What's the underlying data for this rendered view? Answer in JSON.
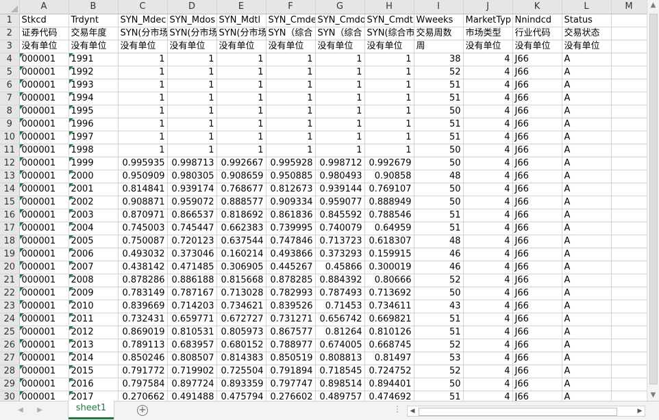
{
  "sheet": {
    "col_letters": [
      "A",
      "B",
      "C",
      "D",
      "E",
      "F",
      "G",
      "H",
      "I",
      "J",
      "K",
      "L",
      "M"
    ],
    "fields": [
      "Stkcd",
      "Trdynt",
      "SYN_Mdec",
      "SYN_Mdos",
      "SYN_Mdtl",
      "SYN_Cmde",
      "SYN_Cmdo",
      "SYN_Cmdt",
      "Wweeks",
      "MarketTyp",
      "Nnindcd",
      "Status",
      ""
    ],
    "cn_names": [
      "证券代码",
      "交易年度",
      "SYN(分市场",
      "SYN(分市场",
      "SYN(分市场",
      "SYN（综合",
      "SYN（综合",
      "SYN(综合市",
      "交易周数",
      "市场类型",
      "行业代码",
      "交易状态",
      ""
    ],
    "units": [
      "没有单位",
      "没有单位",
      "没有单位",
      "没有单位",
      "没有单位",
      "没有单位",
      "没有单位",
      "没有单位",
      "周",
      "没有单位",
      "没有单位",
      "没有单位",
      ""
    ],
    "records": [
      [
        "000001",
        "1991",
        "1",
        "1",
        "1",
        "1",
        "1",
        "1",
        "38",
        "4",
        "J66",
        "A"
      ],
      [
        "000001",
        "1992",
        "1",
        "1",
        "1",
        "1",
        "1",
        "1",
        "52",
        "4",
        "J66",
        "A"
      ],
      [
        "000001",
        "1993",
        "1",
        "1",
        "1",
        "1",
        "1",
        "1",
        "51",
        "4",
        "J66",
        "A"
      ],
      [
        "000001",
        "1994",
        "1",
        "1",
        "1",
        "1",
        "1",
        "1",
        "51",
        "4",
        "J66",
        "A"
      ],
      [
        "000001",
        "1995",
        "1",
        "1",
        "1",
        "1",
        "1",
        "1",
        "50",
        "4",
        "J66",
        "A"
      ],
      [
        "000001",
        "1996",
        "1",
        "1",
        "1",
        "1",
        "1",
        "1",
        "51",
        "4",
        "J66",
        "A"
      ],
      [
        "000001",
        "1997",
        "1",
        "1",
        "1",
        "1",
        "1",
        "1",
        "51",
        "4",
        "J66",
        "A"
      ],
      [
        "000001",
        "1998",
        "1",
        "1",
        "1",
        "1",
        "1",
        "1",
        "50",
        "4",
        "J66",
        "A"
      ],
      [
        "000001",
        "1999",
        "0.995935",
        "0.998713",
        "0.992667",
        "0.995928",
        "0.998712",
        "0.992679",
        "50",
        "4",
        "J66",
        "A"
      ],
      [
        "000001",
        "2000",
        "0.950909",
        "0.980305",
        "0.908659",
        "0.950885",
        "0.980493",
        "0.90858",
        "48",
        "4",
        "J66",
        "A"
      ],
      [
        "000001",
        "2001",
        "0.814841",
        "0.939174",
        "0.768677",
        "0.812673",
        "0.939144",
        "0.769107",
        "50",
        "4",
        "J66",
        "A"
      ],
      [
        "000001",
        "2002",
        "0.908871",
        "0.959072",
        "0.888577",
        "0.909334",
        "0.959077",
        "0.888949",
        "50",
        "4",
        "J66",
        "A"
      ],
      [
        "000001",
        "2003",
        "0.870971",
        "0.866537",
        "0.818692",
        "0.861836",
        "0.845592",
        "0.788546",
        "51",
        "4",
        "J66",
        "A"
      ],
      [
        "000001",
        "2004",
        "0.745003",
        "0.745447",
        "0.662383",
        "0.739995",
        "0.740079",
        "0.64959",
        "51",
        "4",
        "J66",
        "A"
      ],
      [
        "000001",
        "2005",
        "0.750087",
        "0.720123",
        "0.637544",
        "0.747846",
        "0.713723",
        "0.618307",
        "48",
        "4",
        "J66",
        "A"
      ],
      [
        "000001",
        "2006",
        "0.493032",
        "0.373046",
        "0.160214",
        "0.493866",
        "0.373293",
        "0.159915",
        "46",
        "4",
        "J66",
        "A"
      ],
      [
        "000001",
        "2007",
        "0.438142",
        "0.471485",
        "0.306905",
        "0.445267",
        "0.45866",
        "0.300019",
        "46",
        "4",
        "J66",
        "A"
      ],
      [
        "000001",
        "2008",
        "0.878286",
        "0.886188",
        "0.815668",
        "0.878285",
        "0.884392",
        "0.80666",
        "52",
        "4",
        "J66",
        "A"
      ],
      [
        "000001",
        "2009",
        "0.783149",
        "0.787167",
        "0.713028",
        "0.782993",
        "0.787493",
        "0.713692",
        "50",
        "4",
        "J66",
        "A"
      ],
      [
        "000001",
        "2010",
        "0.839669",
        "0.714203",
        "0.734621",
        "0.839526",
        "0.71453",
        "0.734611",
        "43",
        "4",
        "J66",
        "A"
      ],
      [
        "000001",
        "2011",
        "0.732431",
        "0.659771",
        "0.672727",
        "0.731271",
        "0.656742",
        "0.669821",
        "51",
        "4",
        "J66",
        "A"
      ],
      [
        "000001",
        "2012",
        "0.869019",
        "0.810531",
        "0.805973",
        "0.867577",
        "0.81264",
        "0.810126",
        "51",
        "4",
        "J66",
        "A"
      ],
      [
        "000001",
        "2013",
        "0.789113",
        "0.683957",
        "0.680152",
        "0.788977",
        "0.674005",
        "0.668745",
        "52",
        "4",
        "J66",
        "A"
      ],
      [
        "000001",
        "2014",
        "0.850246",
        "0.808507",
        "0.814383",
        "0.850519",
        "0.808813",
        "0.81497",
        "53",
        "4",
        "J66",
        "A"
      ],
      [
        "000001",
        "2015",
        "0.791772",
        "0.719902",
        "0.725504",
        "0.791894",
        "0.718545",
        "0.724752",
        "52",
        "4",
        "J66",
        "A"
      ],
      [
        "000001",
        "2016",
        "0.797584",
        "0.897724",
        "0.893359",
        "0.797747",
        "0.898514",
        "0.894401",
        "50",
        "4",
        "J66",
        "A"
      ],
      [
        "000001",
        "2017",
        "0.270662",
        "0.491488",
        "0.475794",
        "0.276602",
        "0.489757",
        "0.474692",
        "51",
        "4",
        "J66",
        "A"
      ]
    ],
    "numeric_cols": [
      2,
      3,
      4,
      5,
      6,
      7,
      8,
      9
    ],
    "flag_cols": [
      0,
      1
    ]
  },
  "tabs": [
    {
      "label": "sheet1",
      "active": true
    }
  ],
  "add_sheet_icon": "plus-circle-icon",
  "colors": {
    "accent": "#1e7a3a",
    "header_bg": "#e6e6e6",
    "gridline": "#d4d4d4"
  }
}
